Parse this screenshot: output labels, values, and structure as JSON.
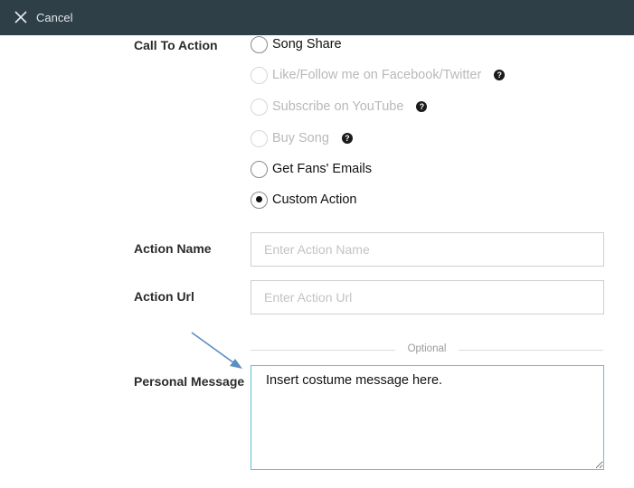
{
  "topbar": {
    "cancel_label": "Cancel"
  },
  "call_to_action": {
    "label": "Call To Action",
    "options": [
      {
        "label": "Song Share",
        "disabled": false,
        "checked": false,
        "help": false
      },
      {
        "label": "Like/Follow me on Facebook/Twitter",
        "disabled": true,
        "checked": false,
        "help": true
      },
      {
        "label": "Subscribe on YouTube",
        "disabled": true,
        "checked": false,
        "help": true
      },
      {
        "label": "Buy Song",
        "disabled": true,
        "checked": false,
        "help": true
      },
      {
        "label": "Get Fans' Emails",
        "disabled": false,
        "checked": false,
        "help": false
      },
      {
        "label": "Custom Action",
        "disabled": false,
        "checked": true,
        "help": false
      }
    ],
    "help_glyph": "?"
  },
  "action_name": {
    "label": "Action Name",
    "placeholder": "Enter Action Name",
    "value": ""
  },
  "action_url": {
    "label": "Action Url",
    "placeholder": "Enter Action Url",
    "value": ""
  },
  "optional_divider": {
    "text": "Optional"
  },
  "personal_message": {
    "label": "Personal Message",
    "value": "Insert costume message here."
  },
  "colors": {
    "topbar": "#2f3f48",
    "focus_border": "#5fc2d6",
    "annotation_arrow": "#5b8fc4",
    "disabled_text": "#b9b9b9"
  }
}
